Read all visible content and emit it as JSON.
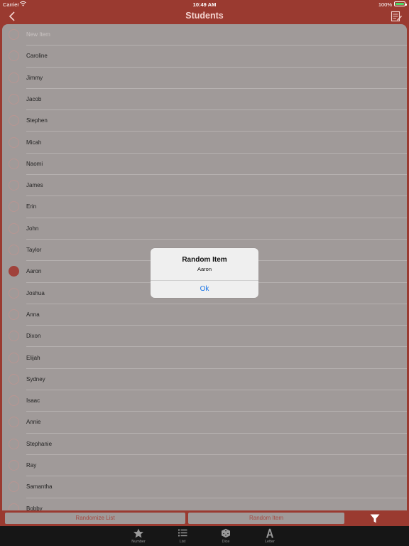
{
  "status": {
    "carrier": "Carrier",
    "time": "10:49 AM",
    "battery": "100%",
    "battery_color": "#4cd964"
  },
  "nav": {
    "title": "Students",
    "back_icon": "chevron-left-icon",
    "edit_icon": "edit-list-icon"
  },
  "list": {
    "placeholder": "New Item",
    "items": [
      {
        "name": "Caroline",
        "selected": false
      },
      {
        "name": "Jimmy",
        "selected": false
      },
      {
        "name": "Jacob",
        "selected": false
      },
      {
        "name": "Stephen",
        "selected": false
      },
      {
        "name": "Micah",
        "selected": false
      },
      {
        "name": "Naomi",
        "selected": false
      },
      {
        "name": "James",
        "selected": false
      },
      {
        "name": "Erin",
        "selected": false
      },
      {
        "name": "John",
        "selected": false
      },
      {
        "name": "Taylor",
        "selected": false
      },
      {
        "name": "Aaron",
        "selected": true
      },
      {
        "name": "Joshua",
        "selected": false
      },
      {
        "name": "Anna",
        "selected": false
      },
      {
        "name": "Dixon",
        "selected": false
      },
      {
        "name": "Elijah",
        "selected": false
      },
      {
        "name": "Sydney",
        "selected": false
      },
      {
        "name": "Isaac",
        "selected": false
      },
      {
        "name": "Annie",
        "selected": false
      },
      {
        "name": "Stephanie",
        "selected": false
      },
      {
        "name": "Ray",
        "selected": false
      },
      {
        "name": "Samantha",
        "selected": false
      },
      {
        "name": "Bobby",
        "selected": false
      }
    ]
  },
  "actions": {
    "randomize_list": "Randomize List",
    "random_item": "Random Item",
    "filter_icon": "filter-icon"
  },
  "tabs": [
    {
      "label": "Number",
      "icon": "star-icon"
    },
    {
      "label": "List",
      "icon": "list-icon"
    },
    {
      "label": "Dice",
      "icon": "dice-icon"
    },
    {
      "label": "Letter",
      "icon": "letter-a-icon"
    }
  ],
  "dialog": {
    "title": "Random Item",
    "message": "Aaron",
    "ok": "Ok"
  },
  "colors": {
    "accent": "#9a3a30",
    "selected": "#a0423b",
    "link": "#1a74e6"
  }
}
